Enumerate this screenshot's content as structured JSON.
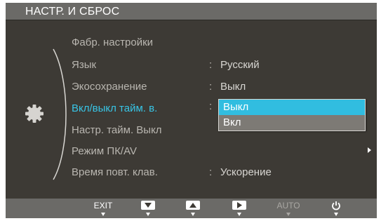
{
  "header": {
    "title": "НАСТР. И СБРОС"
  },
  "menu": {
    "items": [
      {
        "label": "Фабр. настройки",
        "value": ""
      },
      {
        "label": "Язык",
        "value": "Русский"
      },
      {
        "label": "Экосохранение",
        "value": "Выкл"
      },
      {
        "label": "Вкл/выкл тайм. в.",
        "value": ""
      },
      {
        "label": "Настр. тайм. Выкл",
        "value": ""
      },
      {
        "label": "Режим ПК/AV",
        "value": ""
      },
      {
        "label": "Время повт. клав.",
        "value": "Ускорение"
      }
    ],
    "selected_label": "Вкл/выкл тайм. в.",
    "dropdown_options": [
      "Выкл",
      "Вкл"
    ],
    "dropdown_selected": "Выкл",
    "colon": ":"
  },
  "footer": {
    "exit_label": "EXIT",
    "auto_label": "AUTO"
  },
  "colors": {
    "panel": "#3d3a35",
    "bar": "#6b6a67",
    "accent": "#38c5e6",
    "highlight": "#31bde0"
  },
  "icons": [
    "gear-icon",
    "down-arrow-icon",
    "up-arrow-icon",
    "right-arrow-icon",
    "power-icon",
    "submenu-arrow-icon"
  ]
}
